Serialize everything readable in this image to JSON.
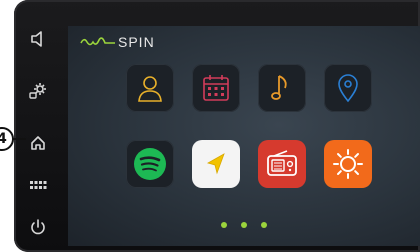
{
  "callout": {
    "number": "4"
  },
  "logo": {
    "text": "SPIN",
    "color": "#9bd43c"
  },
  "side_buttons": [
    {
      "name": "back-icon"
    },
    {
      "name": "settings-icon"
    },
    {
      "name": "home-icon"
    },
    {
      "name": "apps-icon"
    },
    {
      "name": "power-icon"
    }
  ],
  "apps": [
    {
      "name": "contacts-app",
      "color": "#e8b02a"
    },
    {
      "name": "calendar-app",
      "color": "#d23c5a"
    },
    {
      "name": "music-app",
      "color": "#e89a2a"
    },
    {
      "name": "maps-pin-app",
      "color": "#2a7fd4"
    },
    {
      "name": "spotify-app",
      "color": "#1db954"
    },
    {
      "name": "navigation-app",
      "color": "#f2c200"
    },
    {
      "name": "radio-app",
      "color": "#d63a2e"
    },
    {
      "name": "weather-app",
      "color": "#f26a1b"
    }
  ],
  "pager": {
    "pages": 3,
    "color": "#9bd43c"
  }
}
